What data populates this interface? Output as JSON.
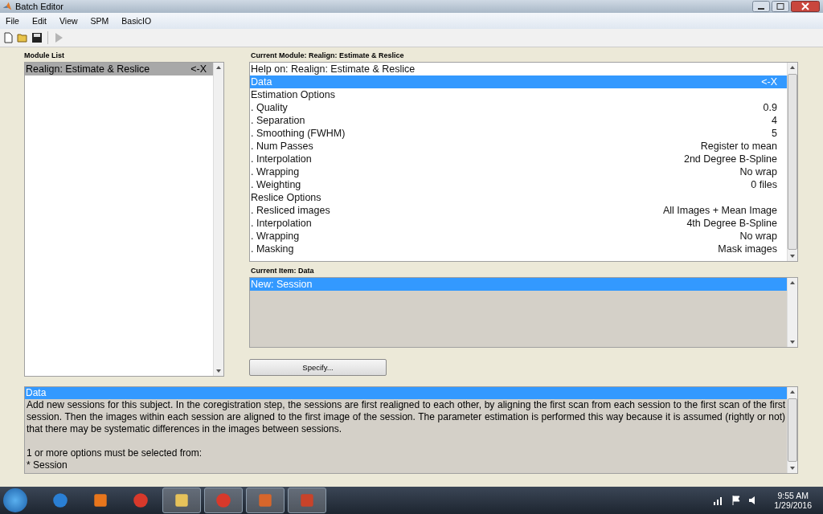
{
  "window": {
    "title": "Batch Editor"
  },
  "menu": [
    "File",
    "Edit",
    "View",
    "SPM",
    "BasicIO"
  ],
  "toolbar": [
    {
      "kind": "new",
      "disabled": false
    },
    {
      "kind": "open",
      "disabled": false
    },
    {
      "kind": "save",
      "disabled": false
    },
    {
      "kind": "run",
      "disabled": true
    }
  ],
  "module_list": {
    "label": "Module List",
    "items": [
      {
        "name": "Realign: Estimate & Reslice",
        "remove": "<-X",
        "selected": true
      }
    ]
  },
  "current_module": {
    "label": "Current Module: Realign: Estimate & Reslice",
    "items": [
      {
        "label": "Help on: Realign: Estimate & Reslice",
        "selected": false
      },
      {
        "label": "Data",
        "value": "<-X",
        "selected": true
      },
      {
        "label": "Estimation Options",
        "selected": false,
        "children": [
          {
            "label": ". Quality",
            "value": "0.9",
            "selected": false
          },
          {
            "label": ". Separation",
            "value": "4",
            "selected": false
          },
          {
            "label": ". Smoothing (FWHM)",
            "value": "5",
            "selected": false
          },
          {
            "label": ". Num Passes",
            "value": "Register to mean",
            "selected": false
          },
          {
            "label": ". Interpolation",
            "value": "2nd Degree B-Spline",
            "selected": false
          },
          {
            "label": ". Wrapping",
            "value": "No wrap",
            "selected": false
          },
          {
            "label": ". Weighting",
            "value": "0 files",
            "selected": false
          }
        ]
      },
      {
        "label": "Reslice Options",
        "selected": false,
        "children": [
          {
            "label": ". Resliced images",
            "value": "All Images + Mean Image",
            "selected": false
          },
          {
            "label": ". Interpolation",
            "value": "4th Degree B-Spline",
            "selected": false
          },
          {
            "label": ". Wrapping",
            "value": "No wrap",
            "selected": false
          },
          {
            "label": ". Masking",
            "value": "Mask images",
            "selected": false
          }
        ]
      }
    ]
  },
  "current_item": {
    "label": "Current Item: Data",
    "items": [
      {
        "label": "New: Session",
        "selected": true
      }
    ],
    "button": "Specify..."
  },
  "help": {
    "title": "Data",
    "paragraph": "Add new sessions for this subject. In the coregistration step, the sessions are first realigned to each other, by aligning the first scan from each session to the first scan of the first session.   Then the images within each session are aligned to the first image of the session. The parameter estimation is performed this way because it is assumed (rightly or not) that there may be systematic differences in the images between sessions.",
    "lines": [
      "1 or more options must be selected from:",
      "* Session"
    ]
  },
  "taskbar": {
    "apps": [
      {
        "kind": "browser",
        "selected": false
      },
      {
        "kind": "media",
        "selected": false
      },
      {
        "kind": "chrome",
        "selected": false
      },
      {
        "kind": "folder",
        "selected": true
      },
      {
        "kind": "chrome",
        "selected": true
      },
      {
        "kind": "matlab",
        "selected": true
      },
      {
        "kind": "slides",
        "selected": true
      }
    ],
    "time": "9:55 AM",
    "date": "1/29/2016"
  }
}
